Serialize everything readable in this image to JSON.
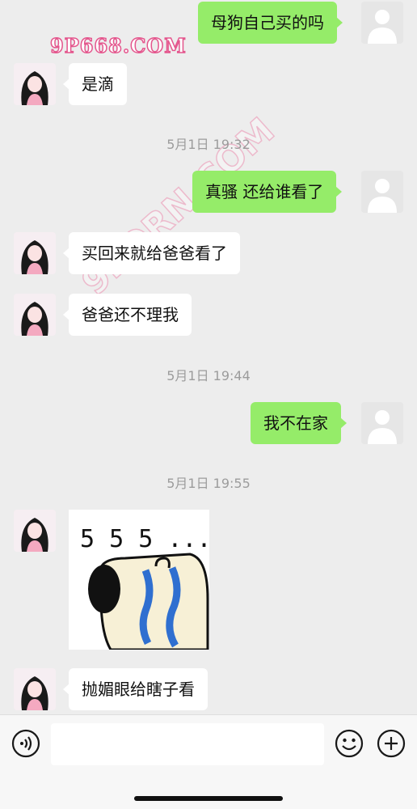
{
  "messages": {
    "m1": "母狗自己买的吗",
    "m2": "是滴",
    "m3": "真骚 还给谁看了",
    "m4": "买回来就给爸爸看了",
    "m5": "爸爸还不理我",
    "m6": "我不在家",
    "m7": "抛媚眼给瞎子看"
  },
  "timestamps": {
    "t1": "5月1日 19:32",
    "t2": "5月1日 19:44",
    "t3": "5月1日 19:55"
  },
  "sticker": {
    "caption": "5 5 5 ..."
  },
  "watermarks": {
    "w1": "9P668.COM",
    "w2": "9PORN.COM"
  },
  "colors": {
    "outgoing_bubble": "#95ec69",
    "incoming_bubble": "#ffffff",
    "background": "#ededed"
  },
  "icons": {
    "voice": "voice-icon",
    "emoji": "emoji-icon",
    "plus": "plus-icon"
  }
}
